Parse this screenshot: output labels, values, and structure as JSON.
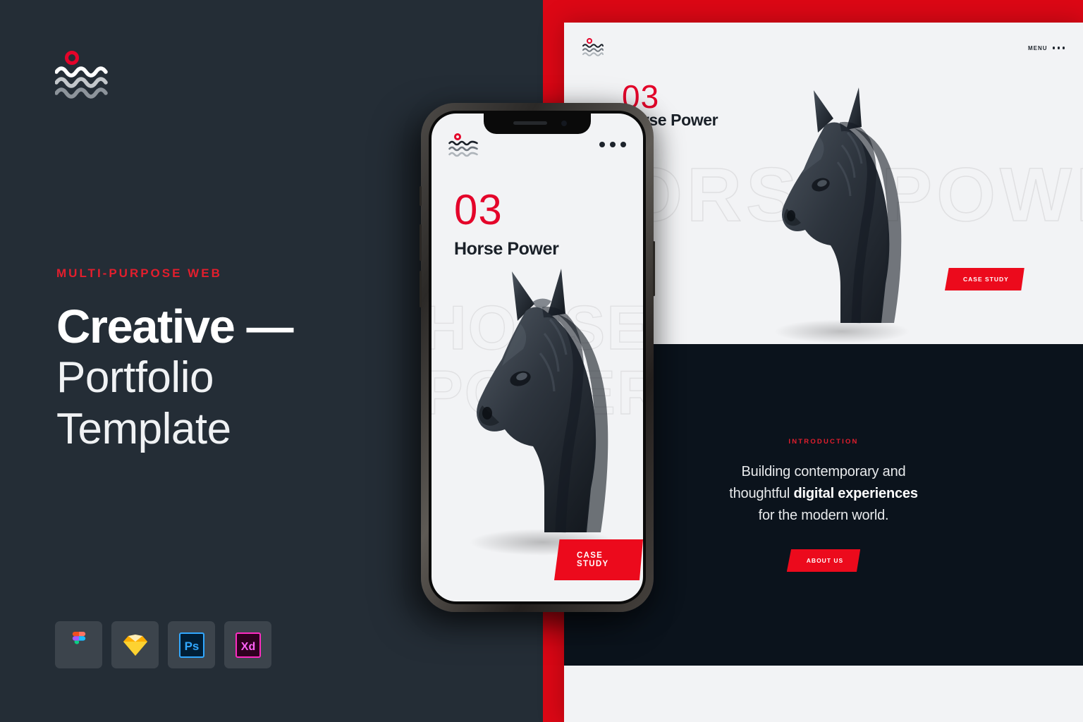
{
  "colors": {
    "dark_panel": "#242d36",
    "accent_red": "#dd0715",
    "button_red": "#ec0a1c",
    "eyebrow_red": "#e31e2d",
    "mock_light": "#f2f3f5",
    "mock_dark": "#0b131c",
    "tile": "#3c444c"
  },
  "brand": {
    "logo_icon": "wave-logo-icon",
    "ring_icon": "red-ring-icon"
  },
  "hero": {
    "eyebrow": "MULTI-PURPOSE WEB",
    "title_line1": "Creative —",
    "title_line2": "Portfolio",
    "title_line3": "Template"
  },
  "app_icons": [
    {
      "name": "figma-icon",
      "label": "Figma"
    },
    {
      "name": "sketch-icon",
      "label": "Sketch"
    },
    {
      "name": "photoshop-icon",
      "label": "Ps"
    },
    {
      "name": "adobe-xd-icon",
      "label": "Xd"
    }
  ],
  "desktop_mockup": {
    "menu_label": "MENU",
    "menu_icon": "three-dots-icon",
    "logo_icon": "wave-logo-icon",
    "hero": {
      "number": "03",
      "title": "Horse Power",
      "ghost_text": "HORSE POWER",
      "cta_label": "CASE STUDY",
      "image_alt": "black-horse-bust-sculpture"
    },
    "intro": {
      "eyebrow": "INTRODUCTION",
      "line1": "Building contemporary and",
      "line2_pre": "thoughtful ",
      "line2_bold": "digital experiences",
      "line3": "for the modern world.",
      "cta_label": "ABOUT US"
    }
  },
  "phone_mockup": {
    "logo_icon": "wave-logo-icon",
    "menu_icon": "three-dots-icon",
    "number": "03",
    "title": "Horse Power",
    "ghost_line1": "HORSE",
    "ghost_line2": "POWER",
    "cta_label": "CASE STUDY",
    "image_alt": "black-horse-bust-sculpture"
  }
}
